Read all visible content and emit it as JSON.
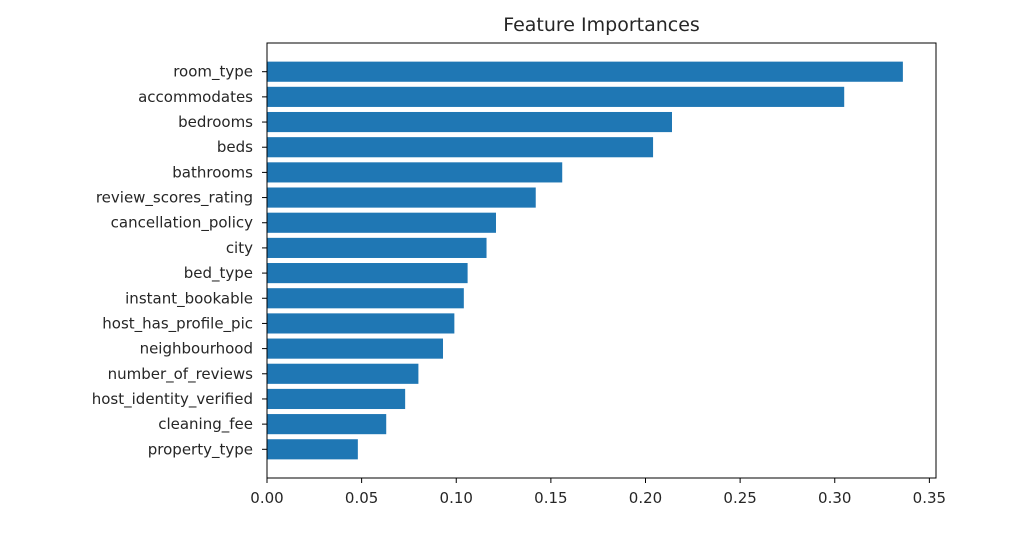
{
  "chart_data": {
    "type": "bar",
    "orientation": "horizontal",
    "title": "Feature Importances",
    "xlabel": "",
    "ylabel": "",
    "xlim": [
      0,
      0.3535
    ],
    "grid": false,
    "bar_color": "#1f77b4",
    "x_ticks": [
      "0.00",
      "0.05",
      "0.10",
      "0.15",
      "0.20",
      "0.25",
      "0.30",
      "0.35"
    ],
    "x_tick_values": [
      0,
      0.05,
      0.1,
      0.15,
      0.2,
      0.25,
      0.3,
      0.35
    ],
    "categories": [
      "room_type",
      "accommodates",
      "bedrooms",
      "beds",
      "bathrooms",
      "review_scores_rating",
      "cancellation_policy",
      "city",
      "bed_type",
      "instant_bookable",
      "host_has_profile_pic",
      "neighbourhood",
      "number_of_reviews",
      "host_identity_verified",
      "cleaning_fee",
      "property_type"
    ],
    "values": [
      0.336,
      0.305,
      0.214,
      0.204,
      0.156,
      0.142,
      0.121,
      0.116,
      0.106,
      0.104,
      0.099,
      0.093,
      0.08,
      0.073,
      0.063,
      0.048
    ]
  }
}
